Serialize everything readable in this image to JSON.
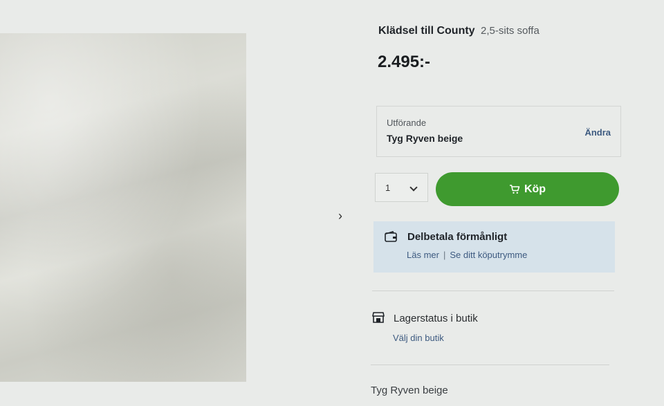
{
  "product": {
    "title": "Klädsel till County",
    "subtitle": "2,5-sits soffa",
    "price": "2.495:-"
  },
  "variant": {
    "label": "Utförande",
    "value": "Tyg Ryven beige",
    "change_label": "Ändra"
  },
  "quantity": {
    "value": "1"
  },
  "buy": {
    "label": "Köp",
    "color": "#3f9a2f"
  },
  "finance": {
    "title": "Delbetala förmånligt",
    "link_read_more": "Läs mer",
    "separator": "|",
    "link_credit": "Se ditt köputrymme"
  },
  "stock": {
    "title": "Lagerstatus i butik",
    "link": "Välj din butik"
  },
  "bottom": {
    "text": "Tyg Ryven beige"
  },
  "icons": {
    "gallery_next": "chevron-right-icon",
    "quantity_dropdown": "chevron-down-icon",
    "buy": "cart-icon",
    "finance": "wallet-icon",
    "stock": "store-icon"
  }
}
